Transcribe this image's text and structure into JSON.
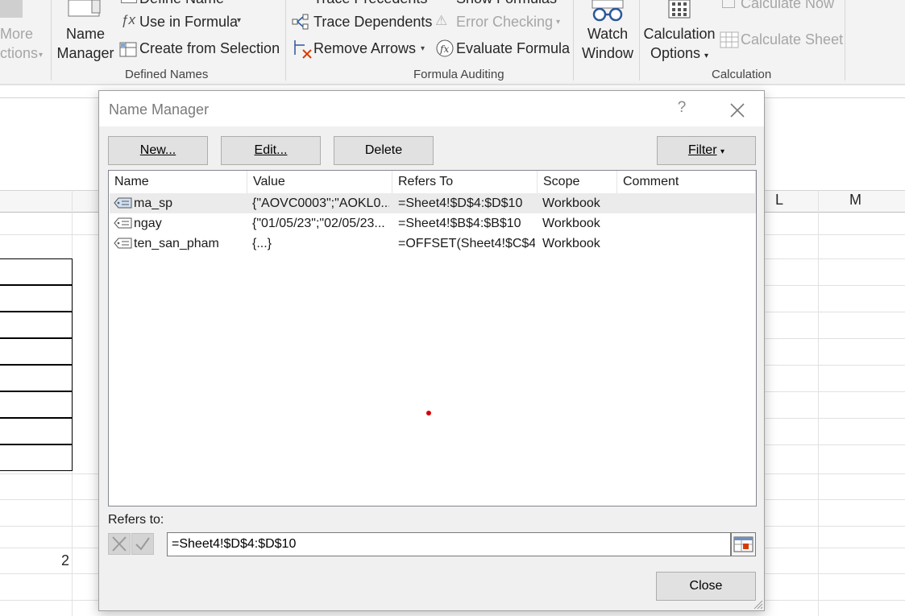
{
  "ribbon": {
    "more_functions_line1": "More",
    "more_functions_line2": "ctions",
    "name_manager_line1": "Name",
    "name_manager_line2": "Manager",
    "define_name": "Define Name",
    "use_in_formula": "Use in Formula",
    "create_from_selection": "Create from Selection",
    "defined_names_group": "Defined Names",
    "trace_precedents": "Trace Precedents",
    "trace_dependents": "Trace Dependents",
    "remove_arrows": "Remove Arrows",
    "show_formulas": "Show Formulas",
    "error_checking": "Error Checking",
    "evaluate_formula": "Evaluate Formula",
    "formula_auditing_group": "Formula Auditing",
    "watch_window_line1": "Watch",
    "watch_window_line2": "Window",
    "calc_options_line1": "Calculation",
    "calc_options_line2": "Options",
    "calculate_now": "Calculate Now",
    "calculate_sheet": "Calculate Sheet",
    "calculation_group": "Calculation"
  },
  "sheet": {
    "col_l": "L",
    "col_m": "M",
    "cell_value": "2"
  },
  "dialog": {
    "title": "Name Manager",
    "help": "?",
    "buttons": {
      "new": "New...",
      "edit": "Edit...",
      "delete": "Delete",
      "filter": "Filter",
      "close": "Close"
    },
    "columns": [
      "Name",
      "Value",
      "Refers To",
      "Scope",
      "Comment"
    ],
    "rows": [
      {
        "name": "ma_sp",
        "value": "{\"AOVC0003\";\"AOKL0...",
        "refers_to": "=Sheet4!$D$4:$D$10",
        "scope": "Workbook",
        "comment": "",
        "selected": true
      },
      {
        "name": "ngay",
        "value": "{\"01/05/23\";\"02/05/23...",
        "refers_to": "=Sheet4!$B$4:$B$10",
        "scope": "Workbook",
        "comment": "",
        "selected": false
      },
      {
        "name": "ten_san_pham",
        "value": "{...}",
        "refers_to": "=OFFSET(Sheet4!$C$4...",
        "scope": "Workbook",
        "comment": "",
        "selected": false
      }
    ],
    "refers_to_label": "Refers to:",
    "refers_to_value": "=Sheet4!$D$4:$D$10"
  },
  "icons": {
    "name_tag": "name-tag-icon",
    "close": "close-icon",
    "cancel_edit": "cancel-x-icon",
    "confirm_edit": "checkmark-icon",
    "collapse": "collapse-dialog-icon",
    "fx": "fx-icon",
    "watch": "glasses-icon",
    "calculator": "calculator-icon"
  },
  "colors": {
    "selected_row": "#ebebeb",
    "ribbon_bg": "#f3f3f3",
    "dialog_bg": "#f0f0f0",
    "accent_blue": "#2b579a"
  }
}
